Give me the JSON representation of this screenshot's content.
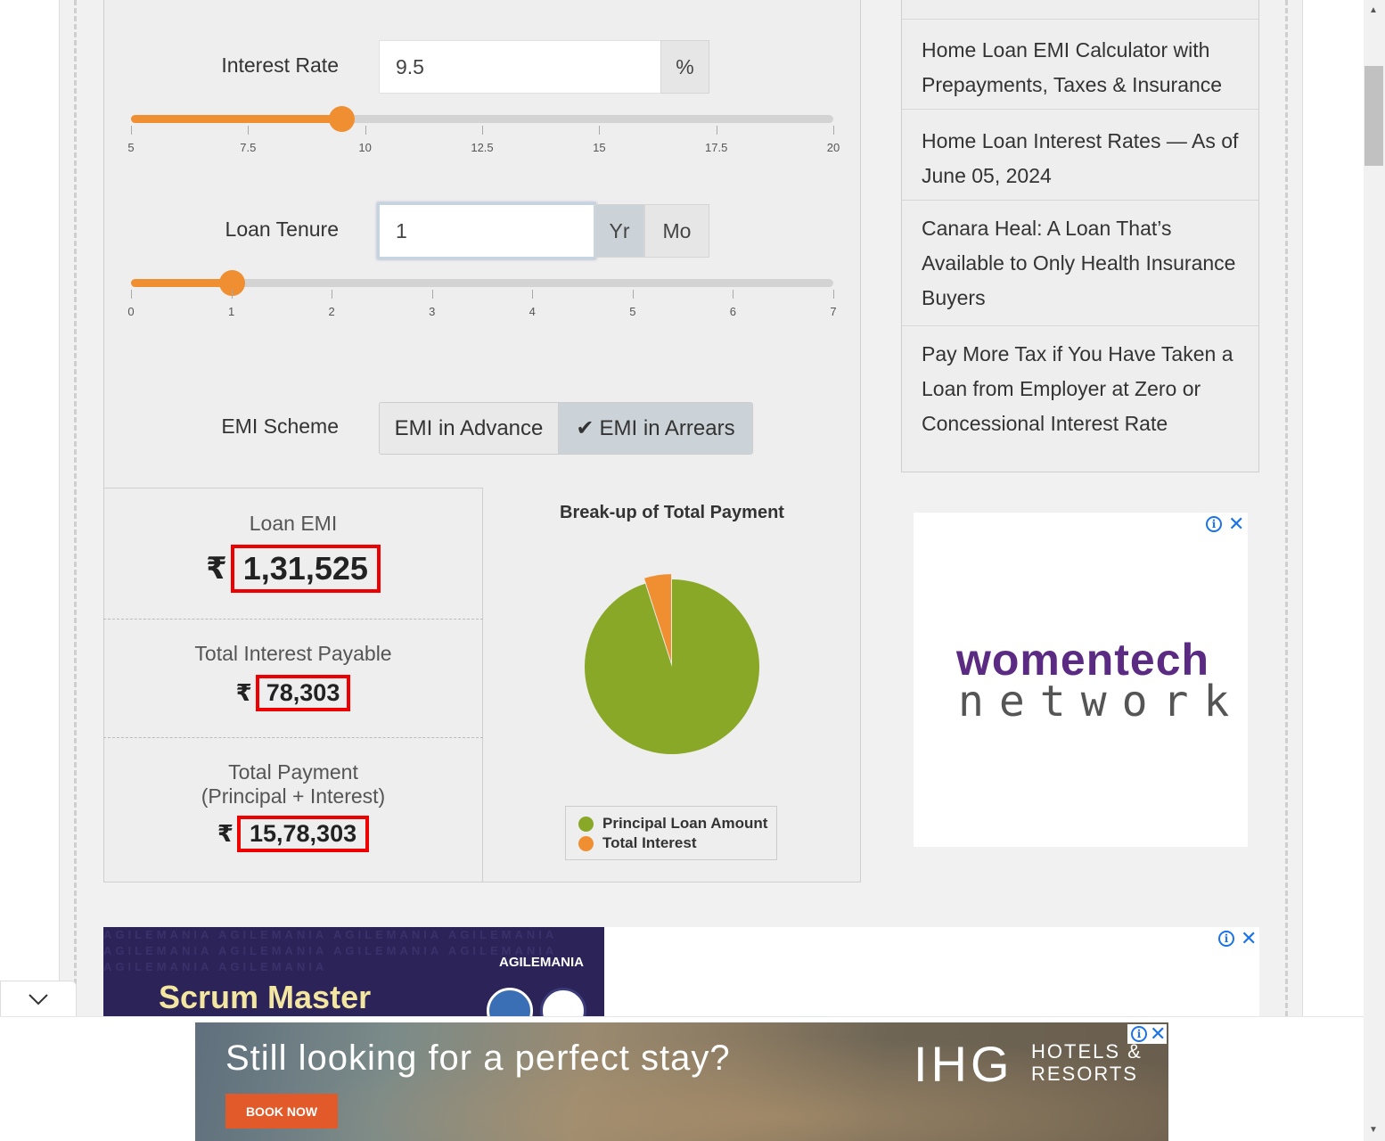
{
  "calculator": {
    "interest_rate": {
      "label": "Interest Rate",
      "value": "9.5",
      "unit": "%",
      "slider_value": 9.5,
      "slider_min": 5,
      "slider_max": 20,
      "ticks": [
        "5",
        "7.5",
        "10",
        "12.5",
        "15",
        "17.5",
        "20"
      ]
    },
    "loan_tenure": {
      "label": "Loan Tenure",
      "value": "1",
      "unit_year": "Yr",
      "unit_month": "Mo",
      "selected_unit": "Yr",
      "slider_value": 1,
      "slider_min": 0,
      "slider_max": 7,
      "ticks": [
        "0",
        "1",
        "2",
        "3",
        "4",
        "5",
        "6",
        "7"
      ]
    },
    "emi_scheme": {
      "label": "EMI Scheme",
      "option_advance": "EMI in Advance",
      "option_arrears": "EMI in Arrears",
      "selected": "EMI in Arrears"
    }
  },
  "results": {
    "currency_symbol": "₹",
    "loan_emi_label": "Loan EMI",
    "loan_emi_value": "1,31,525",
    "total_interest_label": "Total Interest Payable",
    "total_interest_value": "78,303",
    "total_payment_label_line1": "Total Payment",
    "total_payment_label_line2": "(Principal + Interest)",
    "total_payment_value": "15,78,303"
  },
  "chart_data": {
    "type": "pie",
    "title": "Break-up of Total Payment",
    "categories": [
      "Principal Loan Amount",
      "Total Interest"
    ],
    "values": [
      1500000,
      78303
    ],
    "colors": [
      "#8aa827",
      "#ef8f31"
    ],
    "exploded": "Total Interest"
  },
  "sidebar": {
    "items": [
      {
        "label": "Home Loan EMI Calculator with Prepayments, Taxes & Insurance"
      },
      {
        "label": "Home Loan Interest Rates — As of June 05, 2024"
      },
      {
        "label": "Canara Heal: A Loan That’s Available to Only Health Insurance Buyers"
      },
      {
        "label": "Pay More Tax if You Have Taken a Loan from Employer at Zero or Concessional Interest Rate"
      }
    ]
  },
  "ads": {
    "side_ad_brand_line1": "womentech",
    "side_ad_brand_line2": "network",
    "banner_brand": "AGILEMANIA",
    "banner_headline": "Scrum Master",
    "bottom_headline": "Still looking for a perfect stay?",
    "bottom_cta": "BOOK NOW",
    "bottom_brand": "IHG",
    "bottom_brand_sub1": "HOTELS &",
    "bottom_brand_sub2": "RESORTS"
  }
}
